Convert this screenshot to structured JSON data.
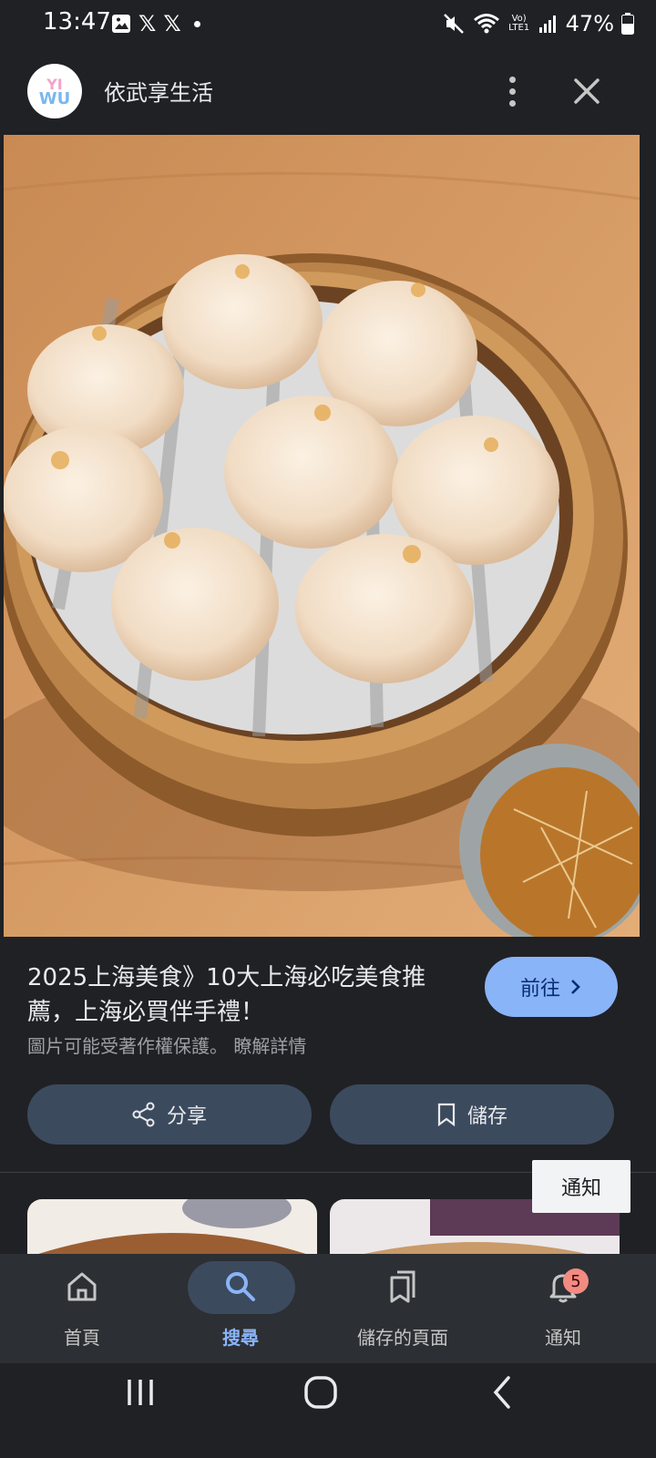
{
  "status_bar": {
    "time": "13:47",
    "left_icons": [
      "gallery-icon",
      "x-logo-icon",
      "x-logo-icon",
      "dot-icon"
    ],
    "x_glyph": "𝕏",
    "right_icons": [
      "mute-icon",
      "wifi-icon",
      "volte-icon",
      "signal-icon",
      "battery-icon"
    ],
    "volte_text": "Vo) LTE1",
    "battery": "47%"
  },
  "header": {
    "site_name": "依武享生活",
    "avatar_text": "YIWU"
  },
  "result": {
    "title": "2025上海美食》10大上海必吃美食推薦，上海必買伴手禮！",
    "copyright": "圖片可能受著作權保護。 瞭解詳情",
    "visit_label": "前往",
    "share_label": "分享",
    "save_label": "儲存"
  },
  "tooltip": "通知",
  "bottom_nav": {
    "items": [
      {
        "label": "首頁",
        "icon": "home-icon"
      },
      {
        "label": "搜尋",
        "icon": "search-icon",
        "active": true
      },
      {
        "label": "儲存的頁面",
        "icon": "saved-pages-icon"
      },
      {
        "label": "通知",
        "icon": "bell-icon",
        "badge": "5"
      }
    ]
  },
  "colors": {
    "background": "#202124",
    "accent": "#8ab4f8",
    "pill": "#3c4a5e",
    "badge": "#f28b82"
  }
}
